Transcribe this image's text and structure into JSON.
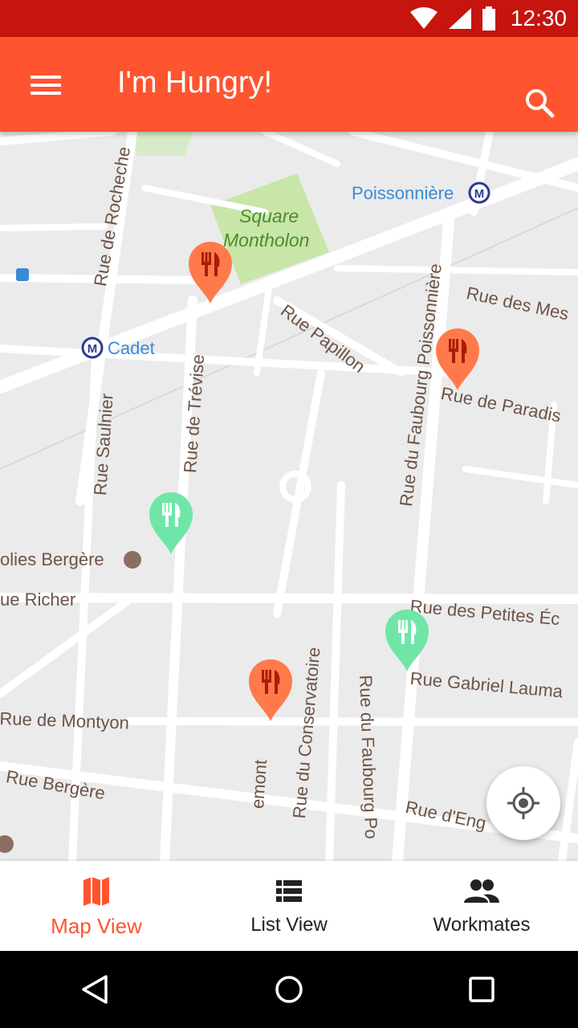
{
  "status_bar": {
    "time": "12:30"
  },
  "app_bar": {
    "title": "I'm Hungry!"
  },
  "map": {
    "park": [
      "Square",
      "Montholon"
    ],
    "metro_stations": [
      "Poissonnière",
      "Cadet"
    ],
    "streets": [
      "Rue de Rocheche",
      "Rue Papillon",
      "Rue du Faubourg Poissonnière",
      "Rue des Mes",
      "Rue de Paradis",
      "Rue de Trévise",
      "Rue Saulnier",
      "olies Bergère",
      "ue Richer",
      "Rue des Petites Éc",
      "Rue Gabriel Lauma",
      "Rue du Conservatoire",
      "Rue du Faubourg Po",
      "Rue de Montyon",
      "Rue Bergère",
      "emont",
      "Rue d'Eng"
    ],
    "markers": [
      {
        "kind": "restaurant",
        "color": "#ff7a4a"
      },
      {
        "kind": "restaurant",
        "color": "#ff7a4a"
      },
      {
        "kind": "restaurant-joined",
        "color": "#6fe6a8"
      },
      {
        "kind": "restaurant-joined",
        "color": "#6fe6a8"
      },
      {
        "kind": "restaurant",
        "color": "#ff7a4a"
      }
    ]
  },
  "bottom_nav": {
    "items": [
      {
        "label": "Map View",
        "icon": "map-icon",
        "active": true
      },
      {
        "label": "List View",
        "icon": "list-icon",
        "active": false
      },
      {
        "label": "Workmates",
        "icon": "people-icon",
        "active": false
      }
    ]
  },
  "colors": {
    "primary": "#ff5430",
    "primary_dark": "#c6140e",
    "marker_orange": "#ff7a4a",
    "marker_green": "#6fe6a8"
  }
}
